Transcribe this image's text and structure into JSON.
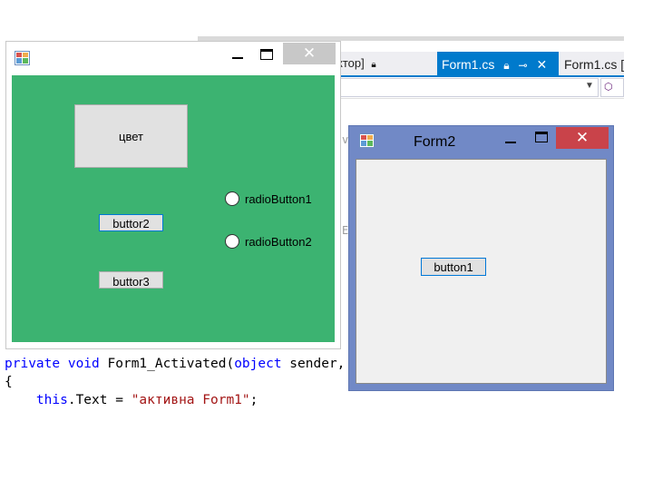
{
  "ide": {
    "tab_inactive": "ктор]",
    "tab_active": "Form1.cs",
    "tab_next": "Form1.cs [",
    "code_fragment_1": "v",
    "code_fragment_2": "E"
  },
  "code": {
    "line1": {
      "kw1": "private",
      "kw2": "void",
      "name": "Form1_Activated(",
      "kw3": "object",
      "rest": " sender,"
    },
    "line2": "{",
    "line3": {
      "indent": "    ",
      "kw": "this",
      "mid": ".Text = ",
      "str": "\"активна Form1\"",
      "end": ";"
    }
  },
  "form1": {
    "title": "",
    "color_button": "цвет",
    "button2": "buttor2",
    "button3": "buttor3",
    "radio1": "radioButton1",
    "radio2": "radioButton2",
    "client_color": "#3cb371"
  },
  "form2": {
    "title": "Form2",
    "button1": "button1",
    "frame_color": "#7189c6",
    "close_color": "#c9434a"
  },
  "icons": {
    "form_icon": "windows-form-icon",
    "close_glyph": "✕"
  }
}
